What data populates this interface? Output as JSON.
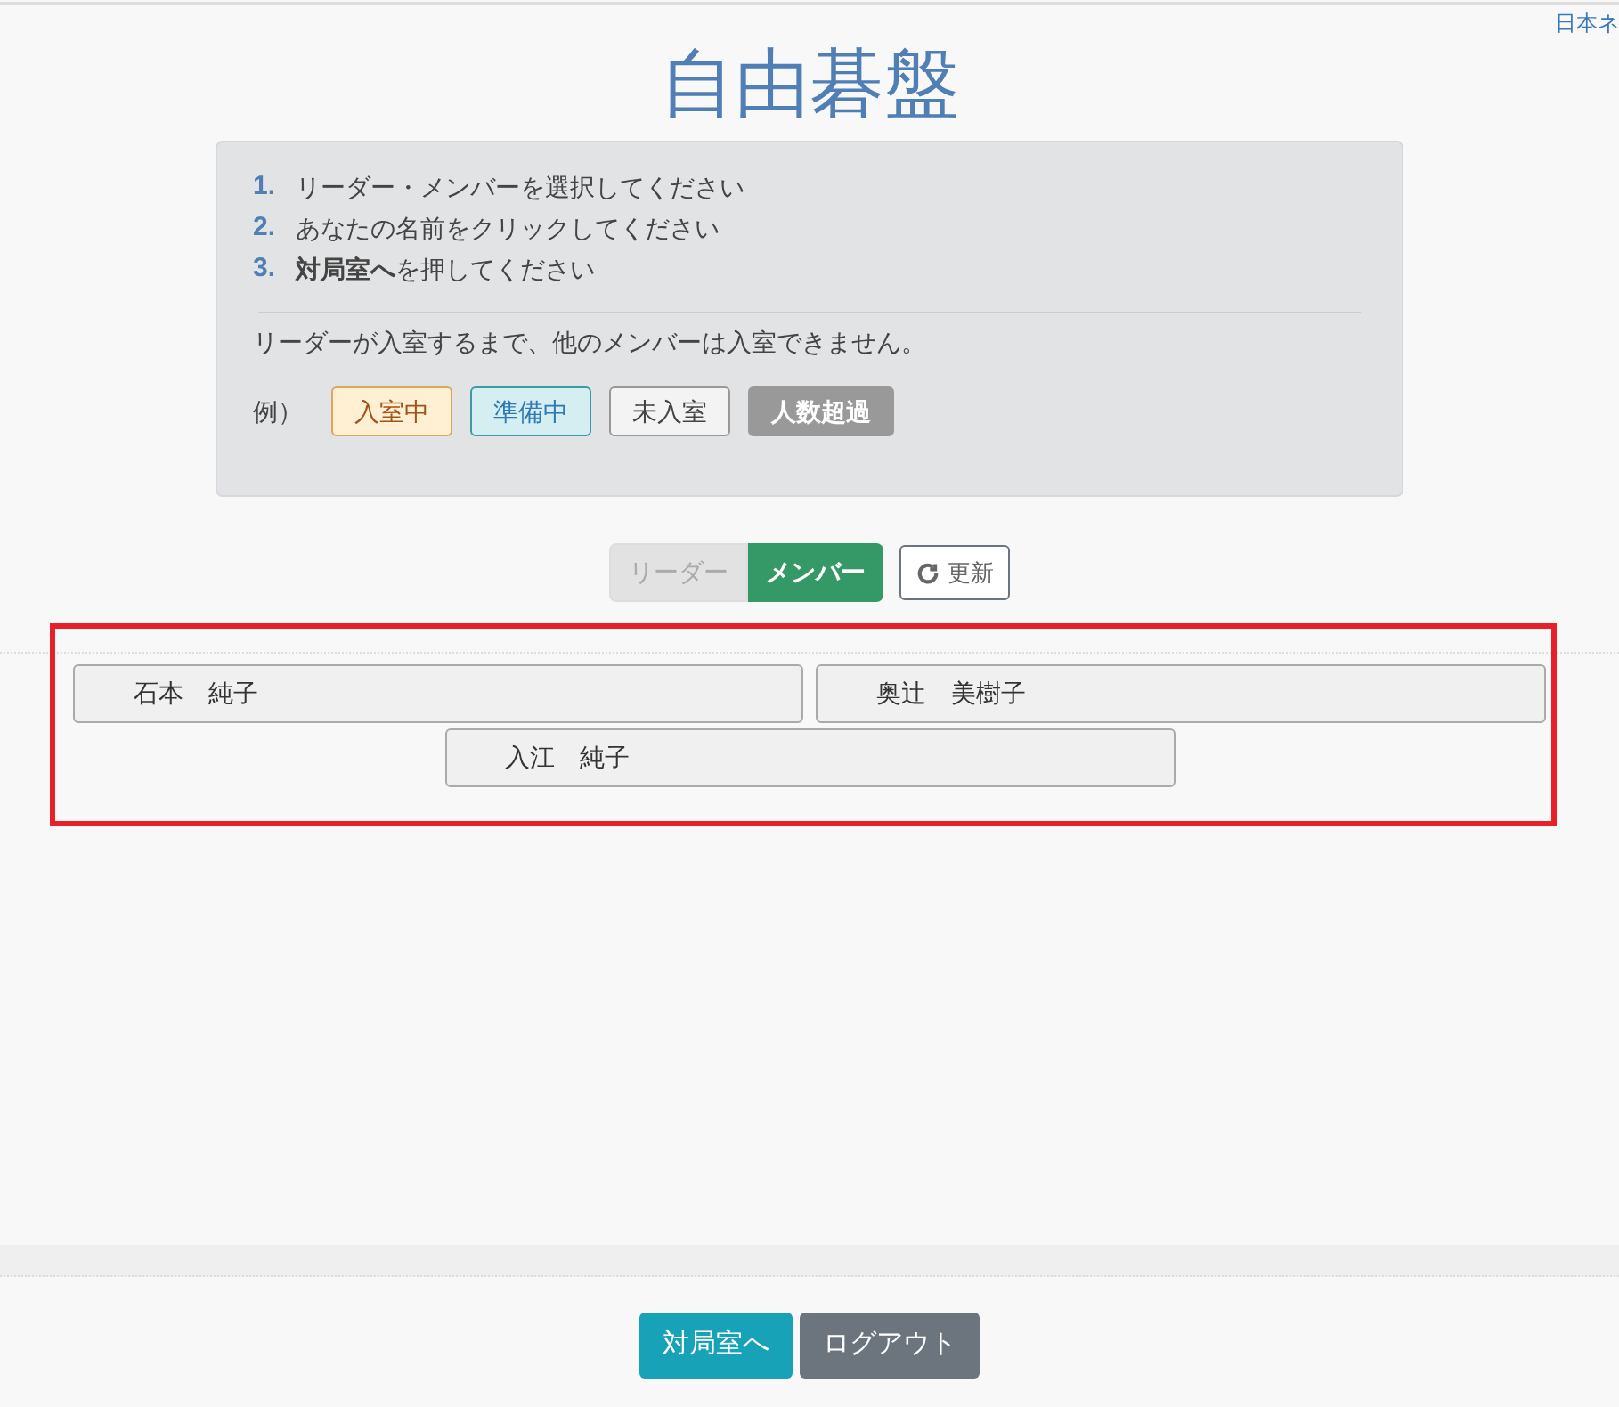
{
  "language_link": "日本ネ",
  "title": "自由碁盤",
  "steps": [
    {
      "number": "1.",
      "text": "リーダー・メンバーを選択してください"
    },
    {
      "number": "2.",
      "text": "あなたの名前をクリックしてください"
    },
    {
      "number": "3.",
      "text": "**対局室へ**を押してください"
    }
  ],
  "note": "リーダーが入室するまで、他のメンバーは入室できません。",
  "legend": {
    "label": "例）",
    "items": [
      {
        "text": "入室中",
        "kind": "entered"
      },
      {
        "text": "準備中",
        "kind": "preparing"
      },
      {
        "text": "未入室",
        "kind": "absent"
      },
      {
        "text": "人数超過",
        "kind": "full"
      }
    ]
  },
  "role_toggle": [
    {
      "label": "リーダー",
      "selected": false
    },
    {
      "label": "メンバー",
      "selected": true
    }
  ],
  "refresh_button": "更新",
  "members": [
    {
      "name": "石本　純子"
    },
    {
      "name": "奥辻　美樹子"
    },
    {
      "name": "入江　純子"
    }
  ],
  "footer_buttons": [
    {
      "label": "対局室へ",
      "kind": "primary"
    },
    {
      "label": "ログアウト",
      "kind": "secondary"
    }
  ]
}
